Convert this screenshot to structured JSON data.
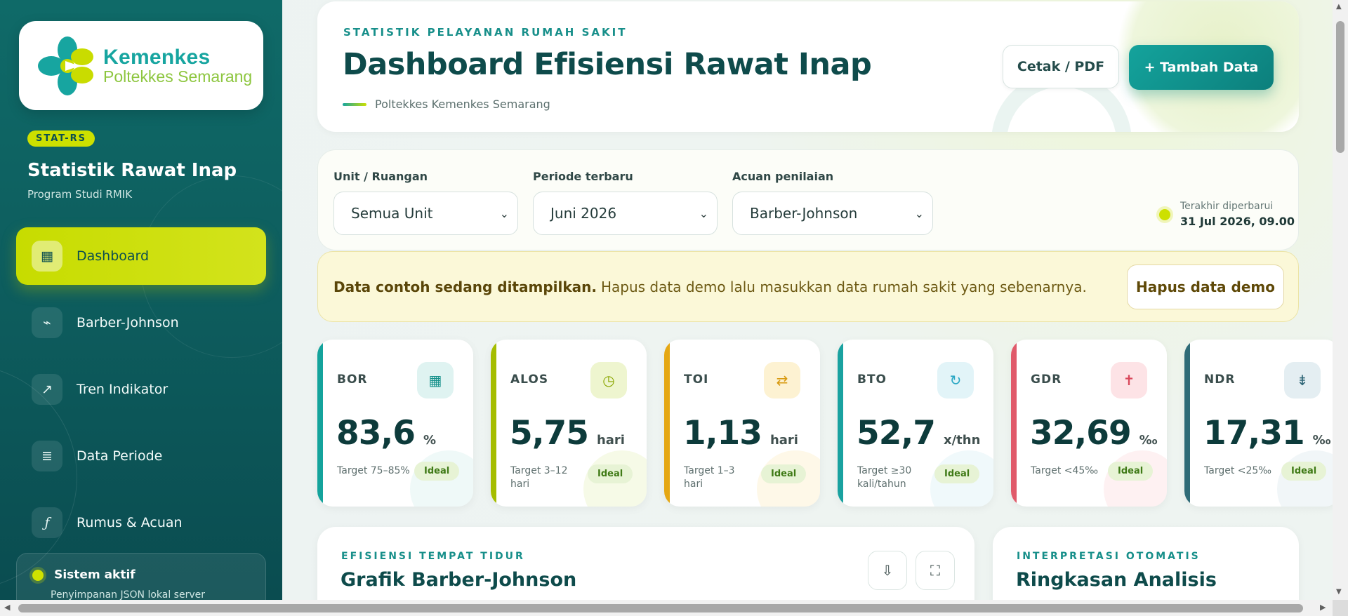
{
  "sidebar": {
    "logo": {
      "line1": "Kemenkes",
      "line2": "Poltekkes Semarang"
    },
    "badge": "STAT-RS",
    "title": "Statistik Rawat Inap",
    "subtitle": "Program Studi RMIK",
    "items": [
      {
        "label": "Dashboard",
        "icon": "grid-icon",
        "active": true
      },
      {
        "label": "Barber-Johnson",
        "icon": "trend-line-icon",
        "active": false
      },
      {
        "label": "Tren Indikator",
        "icon": "arrow-up-right-icon",
        "active": false
      },
      {
        "label": "Data Periode",
        "icon": "list-icon",
        "active": false
      },
      {
        "label": "Rumus & Acuan",
        "icon": "function-icon",
        "active": false
      }
    ],
    "system": {
      "title": "Sistem aktif",
      "subtitle": "Penyimpanan JSON lokal server"
    }
  },
  "header": {
    "kicker": "STATISTIK PELAYANAN RUMAH SAKIT",
    "title": "Dashboard Efisiensi Rawat Inap",
    "subtitle": "Poltekkes Kemenkes Semarang",
    "print_label": "Cetak / PDF",
    "add_label": "+ Tambah Data"
  },
  "filters": {
    "unit": {
      "label": "Unit / Ruangan",
      "value": "Semua Unit"
    },
    "period": {
      "label": "Periode terbaru",
      "value": "Juni 2026"
    },
    "reference": {
      "label": "Acuan penilaian",
      "value": "Barber-Johnson"
    },
    "updated_label": "Terakhir diperbarui",
    "updated_value": "31 Jul 2026, 09.00"
  },
  "banner": {
    "bold": "Data contoh sedang ditampilkan.",
    "text": "Hapus data demo lalu masukkan data rumah sakit yang sebenarnya.",
    "button": "Hapus data demo"
  },
  "kpis": [
    {
      "name": "BOR",
      "value": "83,6",
      "unit": "%",
      "target": "Target 75–85%",
      "status": "Ideal",
      "color": "#14a39c",
      "icon_color": "#16918b",
      "icon_bg": "#dff3f1",
      "glyph": "▦"
    },
    {
      "name": "ALOS",
      "value": "5,75",
      "unit": "hari",
      "target": "Target 3–12 hari",
      "status": "Ideal",
      "color": "#a5bd00",
      "icon_color": "#8aa600",
      "icon_bg": "#eef5cf",
      "glyph": "◷"
    },
    {
      "name": "TOI",
      "value": "1,13",
      "unit": "hari",
      "target": "Target 1–3 hari",
      "status": "Ideal",
      "color": "#e5a713",
      "icon_color": "#d89a10",
      "icon_bg": "#fdf2d2",
      "glyph": "⇄"
    },
    {
      "name": "BTO",
      "value": "52,7",
      "unit": "x/thn",
      "target": "Target ≥30 kali/tahun",
      "status": "Ideal",
      "color": "#1aa2a0",
      "icon_color": "#2aa7c4",
      "icon_bg": "#e2f4f8",
      "glyph": "↻"
    },
    {
      "name": "GDR",
      "value": "32,69",
      "unit": "‰",
      "target": "Target <45‰",
      "status": "Ideal",
      "color": "#e05a6a",
      "icon_color": "#d9485b",
      "icon_bg": "#fde3e6",
      "glyph": "✝"
    },
    {
      "name": "NDR",
      "value": "17,31",
      "unit": "‰",
      "target": "Target <25‰",
      "status": "Ideal",
      "color": "#2f6b77",
      "icon_color": "#2e6576",
      "icon_bg": "#e4eef2",
      "glyph": "⇟"
    }
  ],
  "chart_card": {
    "kicker": "EFISIENSI TEMPAT TIDUR",
    "title": "Grafik Barber-Johnson",
    "download_icon": "download-icon",
    "expand_icon": "expand-icon"
  },
  "summary_card": {
    "kicker": "INTERPRETASI OTOMATIS",
    "title": "Ringkasan Analisis"
  }
}
